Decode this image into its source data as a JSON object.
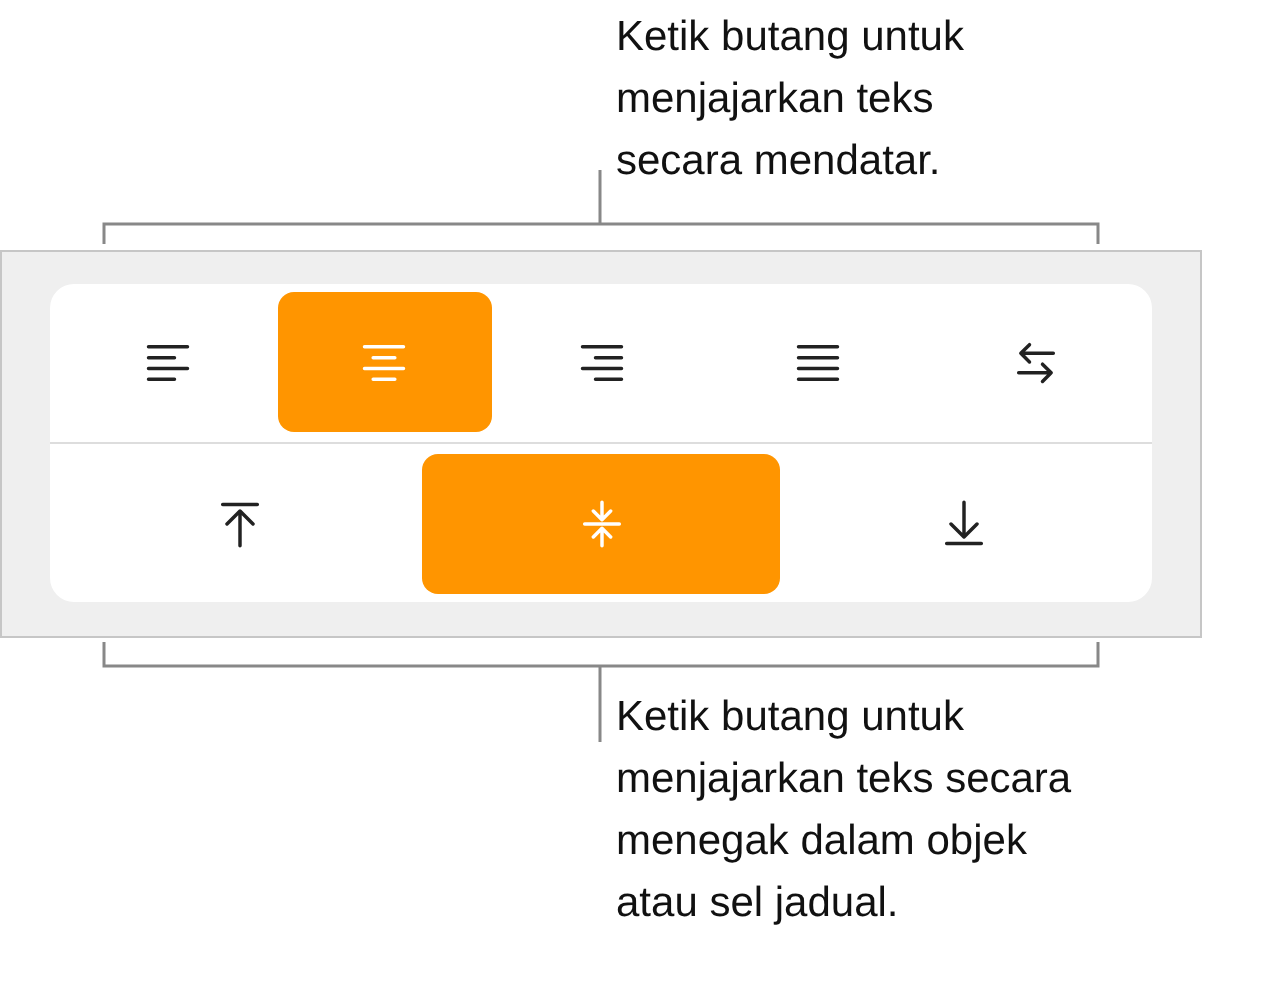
{
  "callout_top": {
    "text": "Ketik butang untuk\nmenjajarkan teks\nsecara mendatar."
  },
  "horizontal_alignment": [
    {
      "kind": "left",
      "selected": false
    },
    {
      "kind": "center",
      "selected": true
    },
    {
      "kind": "right",
      "selected": false
    },
    {
      "kind": "justify",
      "selected": false
    },
    {
      "kind": "direction",
      "selected": false
    }
  ],
  "vertical_alignment": [
    {
      "kind": "top",
      "selected": false
    },
    {
      "kind": "middle",
      "selected": true
    },
    {
      "kind": "bottom",
      "selected": false
    }
  ],
  "callout_bottom": {
    "text": "Ketik butang untuk\nmenjajarkan teks secara\nmenegak dalam objek\natau sel jadual."
  }
}
